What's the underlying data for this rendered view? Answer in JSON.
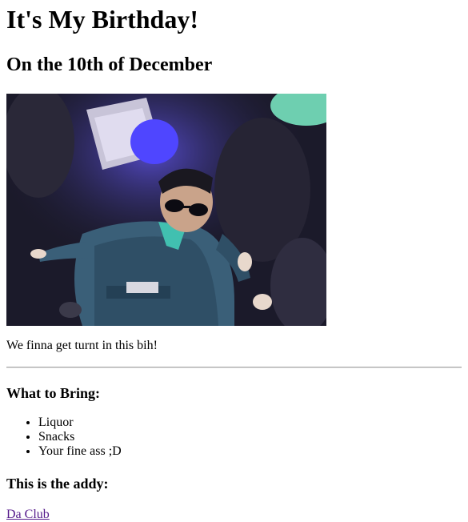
{
  "page": {
    "title": "It's My Birthday!",
    "date_heading": "On the 10th of December",
    "image": {
      "icon": "dancing-kid-gif"
    },
    "tagline": "We finna get turnt in this bih!",
    "bring_heading": "What to Bring:",
    "bring_items": [
      "Liquor",
      "Snacks",
      "Your fine ass ;D"
    ],
    "address_heading": "This is the addy:",
    "address_link": "Da Club"
  },
  "colors": {
    "link": "#551a8b",
    "divider": "#a0a0a0"
  }
}
